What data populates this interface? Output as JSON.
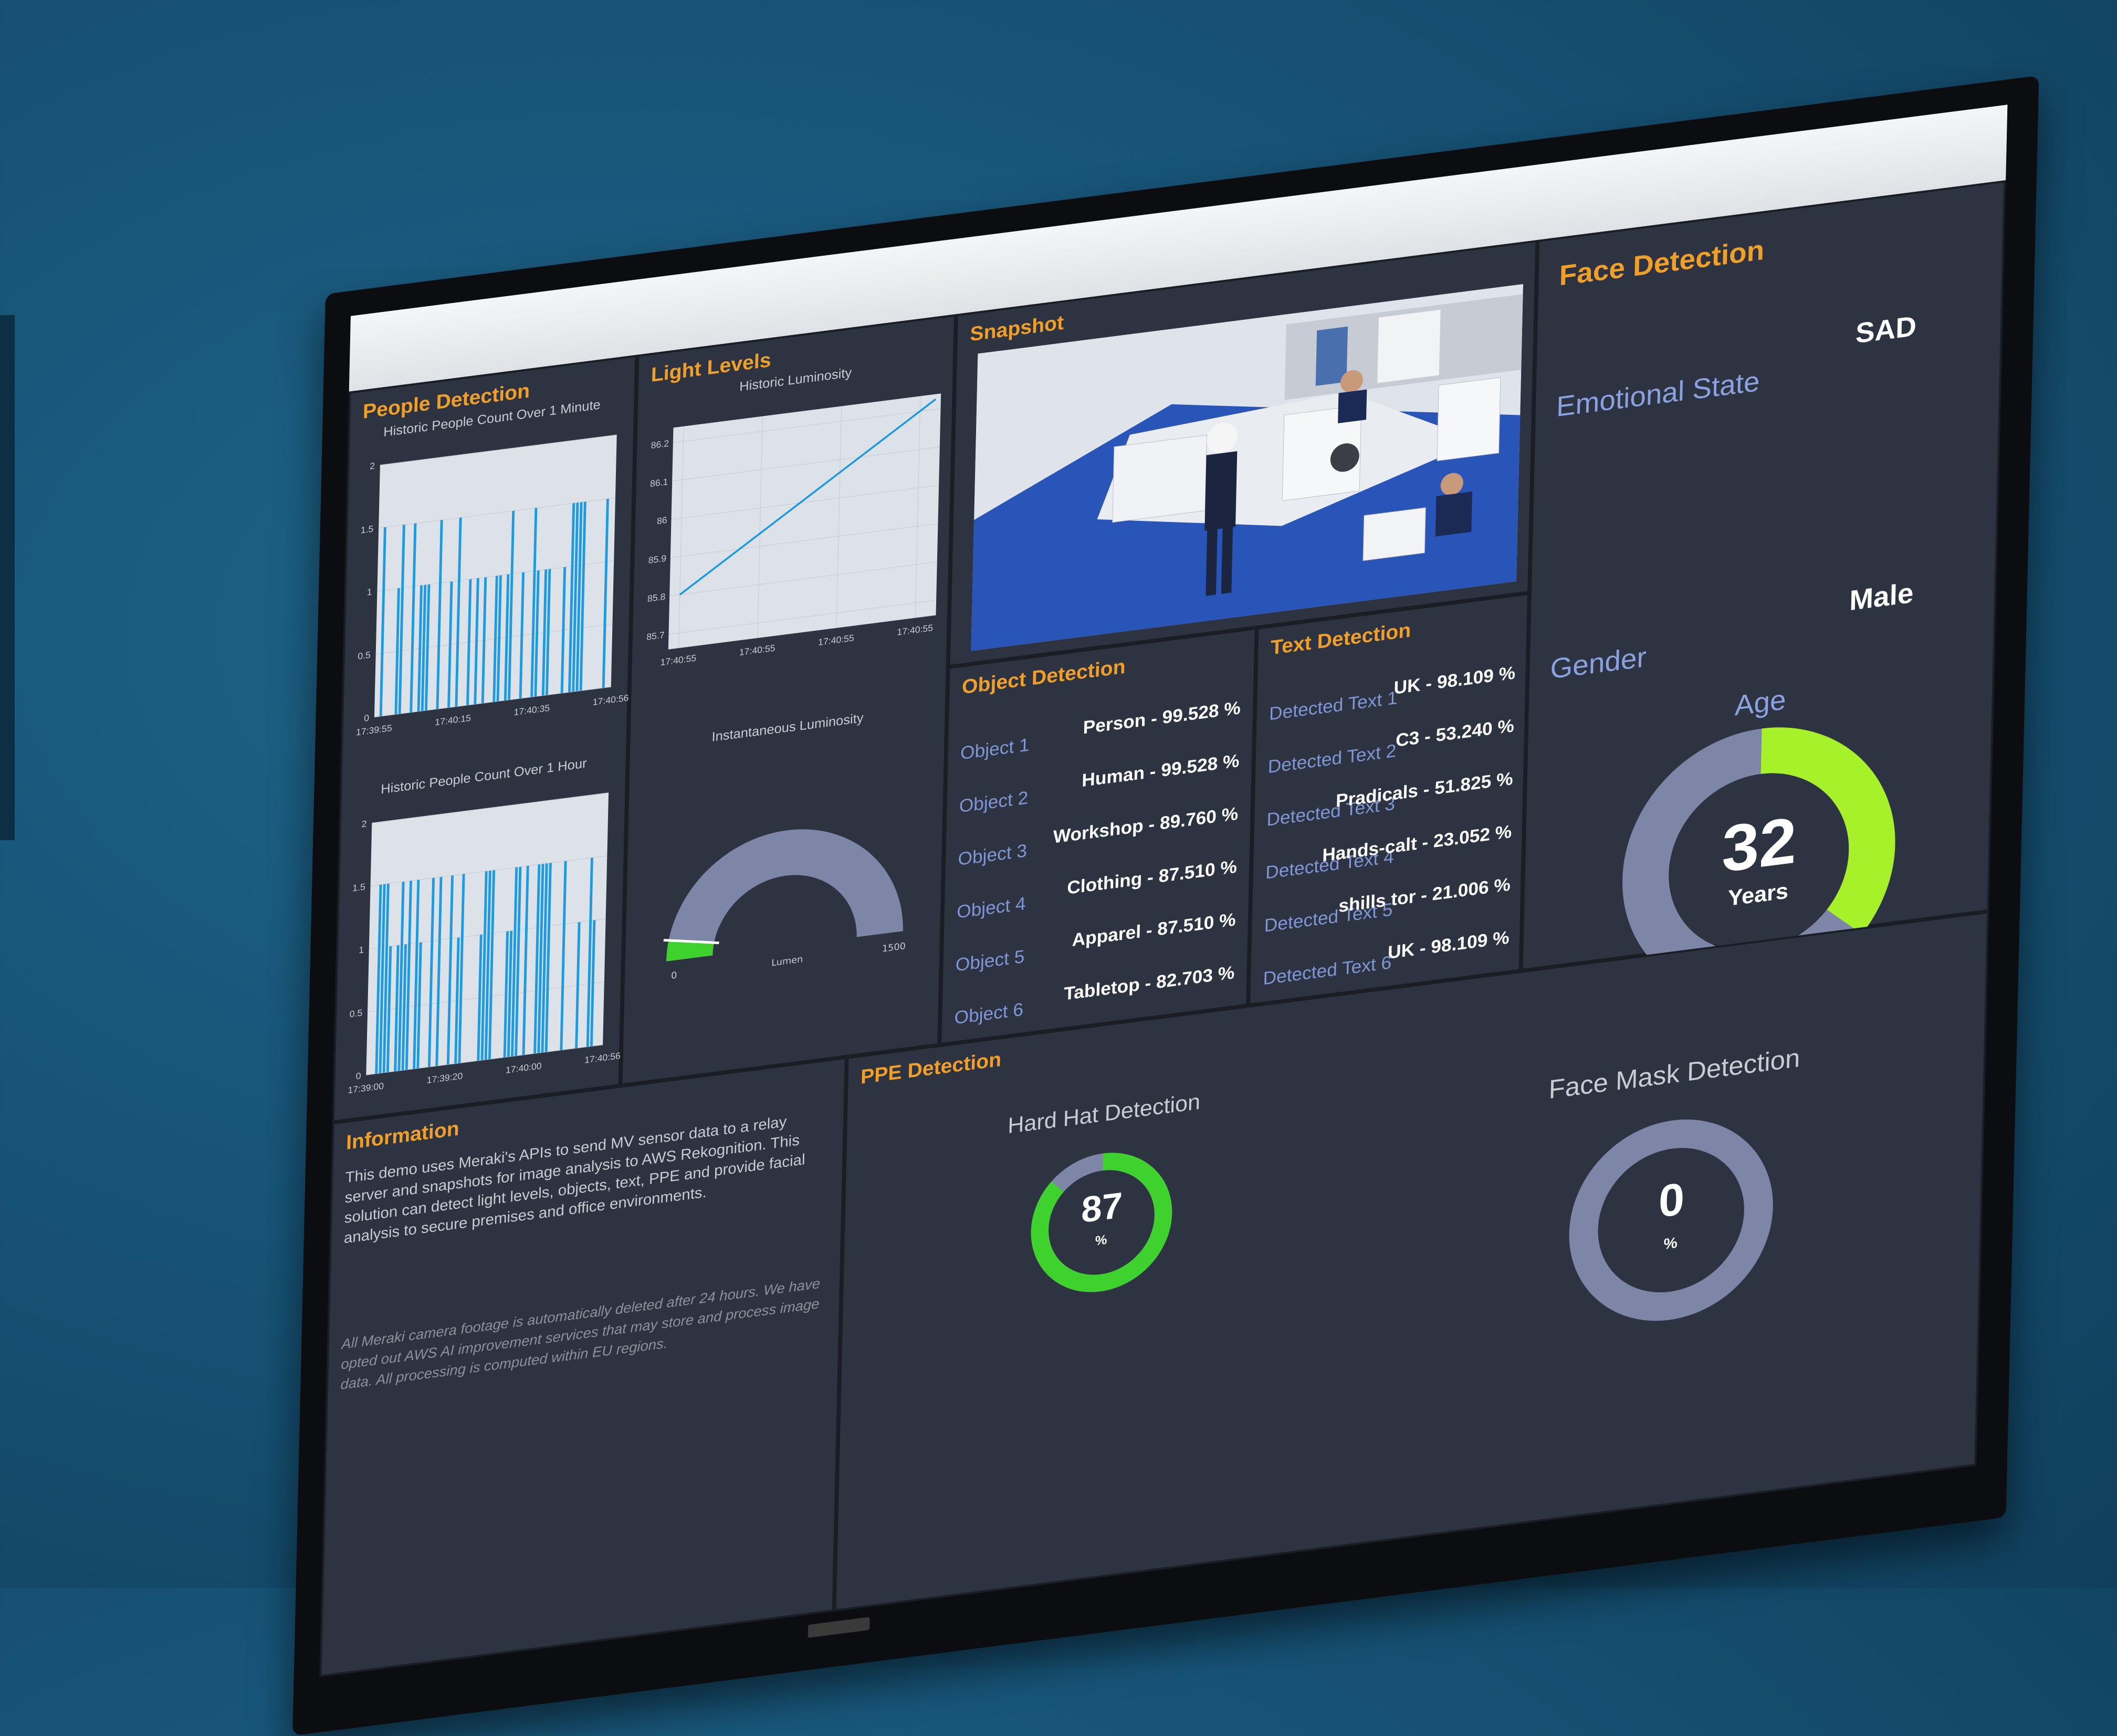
{
  "colors": {
    "accent_orange": "#f0a028",
    "series_blue": "#1e9be0",
    "gauge_green": "#3fd22e",
    "donut_green": "#a6f12a",
    "donut_gray": "#7e86a8",
    "key_text": "#7f97d6"
  },
  "people": {
    "title": "People Detection",
    "minute_chart_title": "Historic People Count Over 1 Minute",
    "minute_x_ticks": [
      "17:39:55",
      "17:40:15",
      "17:40:35",
      "17:40:56"
    ],
    "minute_y_ticks": [
      "2",
      "1.5",
      "1",
      "0.5",
      "0"
    ],
    "hour_chart_title": "Historic People Count Over 1 Hour",
    "hour_x_ticks": [
      "17:39:00",
      "17:39:20",
      "17:40:00",
      "17:40:56"
    ],
    "hour_y_ticks": [
      "2",
      "1.5",
      "1",
      "0.5",
      "0"
    ]
  },
  "light": {
    "title": "Light Levels",
    "historic_title": "Historic Luminosity",
    "historic_y_ticks": [
      "86.2",
      "86.1",
      "86",
      "85.9",
      "85.8",
      "85.7"
    ],
    "historic_x_ticks": [
      "17:40:55",
      "17:40:55",
      "17:40:55",
      "17:40:55"
    ],
    "instant_title": "Instantaneous Luminosity",
    "gauge_min": "0",
    "gauge_unit": "Lumen",
    "gauge_max": "1500",
    "gauge_fraction": 0.057
  },
  "snapshot": {
    "title": "Snapshot"
  },
  "objects": {
    "title": "Object Detection",
    "rows": [
      {
        "key": "Object 1",
        "value": "Person - 99.528 %"
      },
      {
        "key": "Object 2",
        "value": "Human - 99.528 %"
      },
      {
        "key": "Object 3",
        "value": "Workshop - 89.760 %"
      },
      {
        "key": "Object 4",
        "value": "Clothing - 87.510 %"
      },
      {
        "key": "Object 5",
        "value": "Apparel - 87.510 %"
      },
      {
        "key": "Object 6",
        "value": "Tabletop - 82.703 %"
      }
    ]
  },
  "text": {
    "title": "Text Detection",
    "rows": [
      {
        "key": "Detected Text 1",
        "value": "UK - 98.109 %"
      },
      {
        "key": "Detected Text 2",
        "value": "C3 - 53.240 %"
      },
      {
        "key": "Detected Text 3",
        "value": "Pradicals - 51.825 %"
      },
      {
        "key": "Detected Text 4",
        "value": "Hands-calt - 23.052 %"
      },
      {
        "key": "Detected Text 5",
        "value": "shills tor - 21.006 %"
      },
      {
        "key": "Detected Text 6",
        "value": "UK - 98.109 %"
      }
    ]
  },
  "face": {
    "title": "Face Detection",
    "emotion_label": "Emotional State",
    "emotion_value": "SAD",
    "gender_label": "Gender",
    "gender_value": "Male",
    "age_label": "Age",
    "age_value": "32",
    "age_unit": "Years",
    "age_fraction": 0.36
  },
  "info": {
    "title": "Information",
    "paragraph1": "This demo uses Meraki's APIs to send MV sensor data to a relay server and snapshots for image analysis to AWS Rekognition. This solution can detect light levels, objects, text, PPE and provide facial analysis to secure premises and office environments.",
    "paragraph2": "All Meraki camera footage is automatically deleted after 24 hours. We have opted out AWS AI improvement services that may store and process image data. All processing is computed within EU regions."
  },
  "ppe": {
    "title": "PPE Detection",
    "hardhat_title": "Hard Hat Detection",
    "hardhat_value": "87",
    "hardhat_unit": "%",
    "hardhat_fraction": 0.87,
    "mask_title": "Face Mask Detection",
    "mask_value": "0",
    "mask_unit": "%",
    "mask_fraction": 0
  }
}
